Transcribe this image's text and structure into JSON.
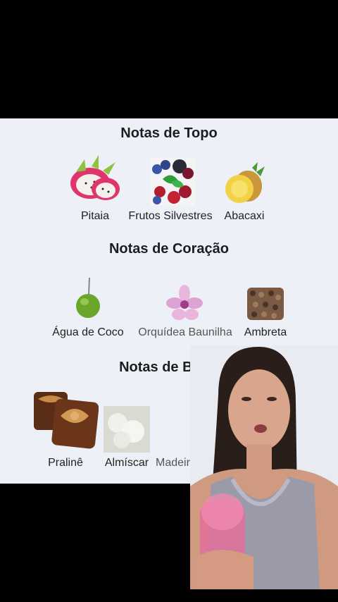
{
  "sections": {
    "top": {
      "title": "Notas de Topo",
      "notes": [
        {
          "label": "Pitaia",
          "icon": "dragon-fruit-icon"
        },
        {
          "label": "Frutos Silvestres",
          "icon": "berries-icon"
        },
        {
          "label": "Abacaxi",
          "icon": "pineapple-icon"
        }
      ]
    },
    "heart": {
      "title": "Notas de Coração",
      "notes": [
        {
          "label": "Água de Coco",
          "icon": "coconut-icon"
        },
        {
          "label": "Orquídea Baunilha",
          "icon": "orchid-icon"
        },
        {
          "label": "Ambreta",
          "icon": "seeds-icon"
        }
      ]
    },
    "base": {
      "title": "Notas de Base",
      "notes": [
        {
          "label": "Pralinê",
          "icon": "praline-icon"
        },
        {
          "label": "Almíscar",
          "icon": "musk-icon"
        },
        {
          "label": "Madeira de",
          "icon": "wood-icon"
        }
      ]
    }
  },
  "overlay": {
    "kind": "presenter-video",
    "icon": "presenter-person"
  }
}
